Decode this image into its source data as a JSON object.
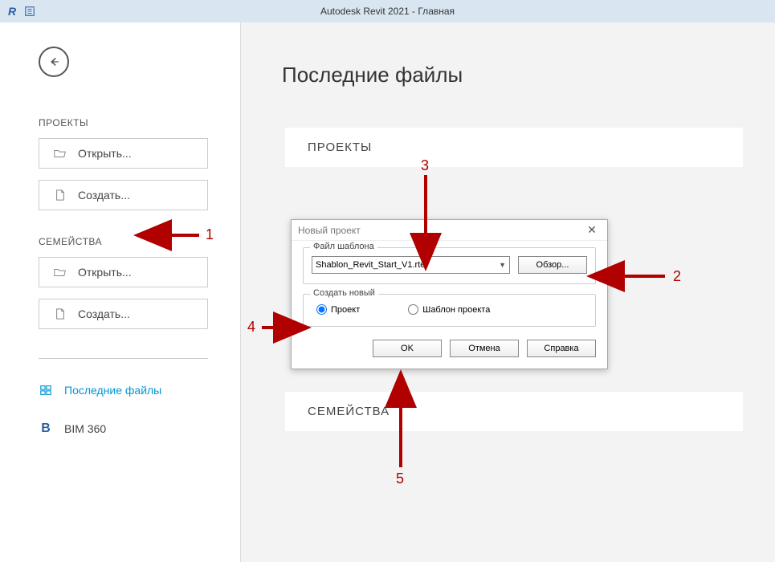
{
  "titlebar": {
    "title": "Autodesk Revit 2021 - Главная"
  },
  "sidebar": {
    "projects_label": "ПРОЕКТЫ",
    "open_label": "Открыть...",
    "create_label": "Создать...",
    "families_label": "СЕМЕЙСТВА",
    "families_open_label": "Открыть...",
    "families_create_label": "Создать...",
    "recent_files_label": "Последние файлы",
    "bim360_label": "BIM 360"
  },
  "content": {
    "page_title": "Последние файлы",
    "section_projects": "ПРОЕКТЫ",
    "section_families": "СЕМЕЙСТВА"
  },
  "dialog": {
    "title": "Новый проект",
    "template_legend": "Файл шаблона",
    "template_value": "Shablon_Revit_Start_V1.rte",
    "browse_label": "Обзор...",
    "create_legend": "Создать новый",
    "radio_project": "Проект",
    "radio_template": "Шаблон проекта",
    "ok_label": "OK",
    "cancel_label": "Отмена",
    "help_label": "Справка"
  },
  "annotations": {
    "n1": "1",
    "n2": "2",
    "n3": "3",
    "n4": "4",
    "n5": "5"
  }
}
